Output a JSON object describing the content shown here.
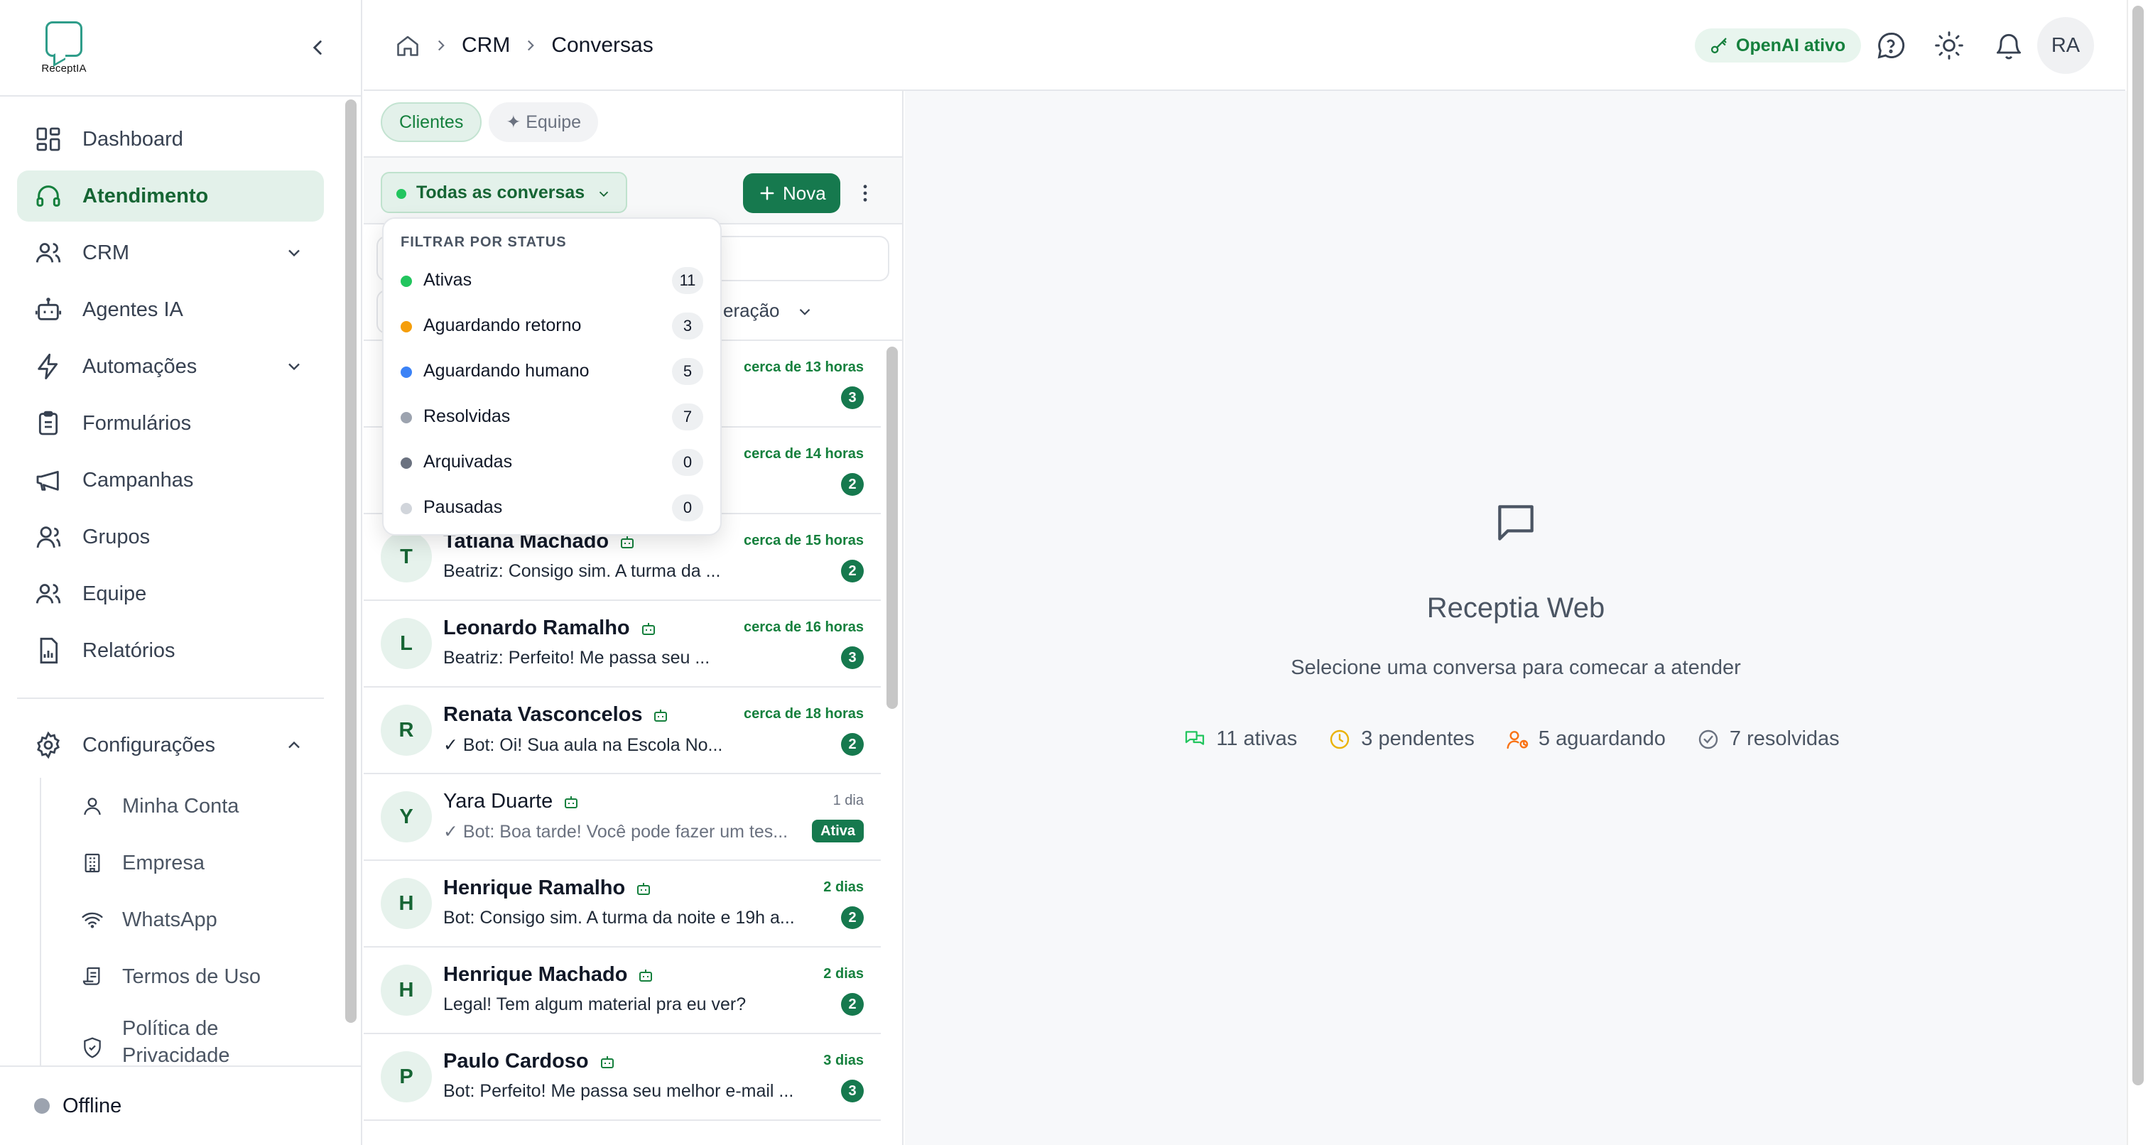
{
  "brand": {
    "logo_text": "ReceptIA"
  },
  "sidebar": {
    "items": [
      {
        "label": "Dashboard",
        "icon": "dashboard-icon"
      },
      {
        "label": "Atendimento",
        "icon": "headphones-icon",
        "active": true
      },
      {
        "label": "CRM",
        "icon": "users-icon",
        "expandable": true
      },
      {
        "label": "Agentes IA",
        "icon": "bot-icon"
      },
      {
        "label": "Automações",
        "icon": "lightning-icon",
        "expandable": true
      },
      {
        "label": "Formulários",
        "icon": "clipboard-icon"
      },
      {
        "label": "Campanhas",
        "icon": "megaphone-icon"
      },
      {
        "label": "Grupos",
        "icon": "group-icon"
      },
      {
        "label": "Equipe",
        "icon": "team-icon"
      },
      {
        "label": "Relatórios",
        "icon": "report-icon"
      }
    ],
    "settings": {
      "label": "Configurações",
      "icon": "gear-icon"
    },
    "settings_items": [
      {
        "label": "Minha Conta",
        "icon": "user-icon"
      },
      {
        "label": "Empresa",
        "icon": "building-icon"
      },
      {
        "label": "WhatsApp",
        "icon": "wifi-icon"
      },
      {
        "label": "Termos de Uso",
        "icon": "scroll-icon"
      },
      {
        "label": "Política de Privacidade",
        "icon": "shield-icon"
      }
    ],
    "status": "Offline"
  },
  "topbar": {
    "breadcrumb": [
      "CRM",
      "Conversas"
    ],
    "openai_status": "OpenAI ativo",
    "avatar_initials": "RA"
  },
  "list": {
    "tabs": {
      "clients": "Clientes",
      "team": "✦ Equipe"
    },
    "status_filter": "Todas as conversas",
    "new_label": "Nova",
    "sort_label_partial": "eração",
    "conversations": [
      {
        "initial": "",
        "name": "",
        "message": "",
        "time": "cerca de 13 horas",
        "count": "3"
      },
      {
        "initial": "",
        "name": "",
        "message": "",
        "time": "cerca de 14 horas",
        "count": "2"
      },
      {
        "initial": "T",
        "name": "Tatiana Machado",
        "message": "Beatriz: Consigo sim. A turma da ...",
        "time": "cerca de 15 horas",
        "count": "2"
      },
      {
        "initial": "L",
        "name": "Leonardo Ramalho",
        "message": "Beatriz: Perfeito! Me passa seu ...",
        "time": "cerca de 16 horas",
        "count": "3"
      },
      {
        "initial": "R",
        "name": "Renata Vasconcelos",
        "message": "✓ Bot: Oi! Sua aula na Escola No...",
        "time": "cerca de 18 horas",
        "count": "2"
      },
      {
        "initial": "Y",
        "name": "Yara Duarte",
        "message": "✓ Bot: Boa tarde! Você pode fazer um tes...",
        "time": "1 dia",
        "count": "Ativa"
      },
      {
        "initial": "H",
        "name": "Henrique Ramalho",
        "message": "Bot: Consigo sim. A turma da noite e 19h a...",
        "time": "2 dias",
        "count": "2"
      },
      {
        "initial": "H",
        "name": "Henrique Machado",
        "message": "Legal! Tem algum material pra eu ver?",
        "time": "2 dias",
        "count": "2"
      },
      {
        "initial": "P",
        "name": "Paulo Cardoso",
        "message": "Bot: Perfeito! Me passa seu melhor e-mail ...",
        "time": "3 dias",
        "count": "3"
      }
    ]
  },
  "dropdown": {
    "header": "FILTRAR POR STATUS",
    "options": [
      {
        "label": "Ativas",
        "count": "11",
        "color": "#22c55e"
      },
      {
        "label": "Aguardando retorno",
        "count": "3",
        "color": "#f59e0b"
      },
      {
        "label": "Aguardando humano",
        "count": "5",
        "color": "#3b82f6"
      },
      {
        "label": "Resolvidas",
        "count": "7",
        "color": "#9ca3af"
      },
      {
        "label": "Arquivadas",
        "count": "0",
        "color": "#6b7280"
      },
      {
        "label": "Pausadas",
        "count": "0",
        "color": "#d1d5db"
      }
    ]
  },
  "main": {
    "title": "Receptia Web",
    "subtitle": "Selecione uma conversa para comecar a atender",
    "stats": [
      {
        "label": "11 ativas",
        "color": "#22c55e",
        "icon": "chat-icon"
      },
      {
        "label": "3 pendentes",
        "color": "#eab308",
        "icon": "clock-icon"
      },
      {
        "label": "5 aguardando",
        "color": "#f97316",
        "icon": "user-clock-icon"
      },
      {
        "label": "7 resolvidas",
        "color": "#6b7280",
        "icon": "check-circle-icon"
      }
    ]
  },
  "colors": {
    "accent": "#16794e",
    "accent_light": "#e3f1ea"
  }
}
